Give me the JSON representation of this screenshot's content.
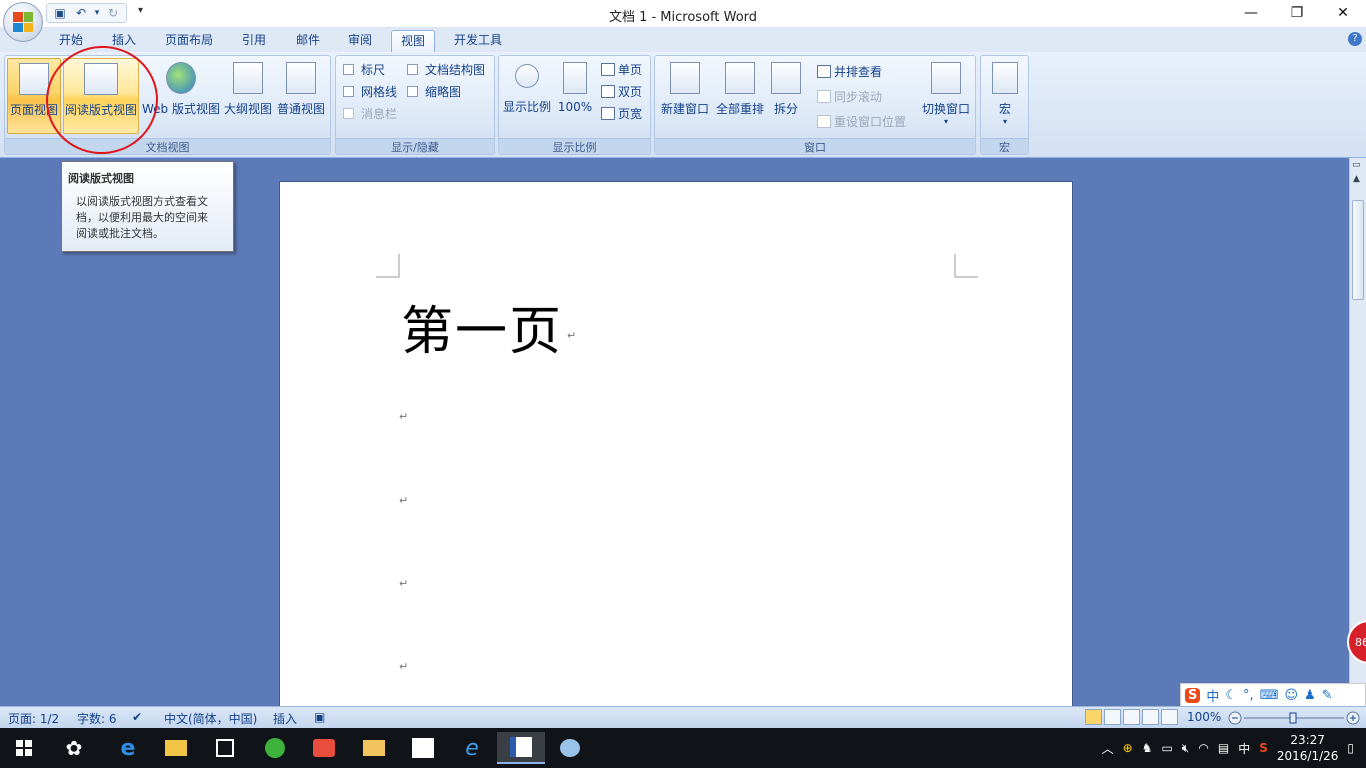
{
  "window": {
    "title": "文档 1 - Microsoft Word"
  },
  "window_controls": {
    "minimize": "—",
    "restore": "❐",
    "close": "✕"
  },
  "qat": {
    "more": "▾"
  },
  "ribbon_tabs": [
    "开始",
    "插入",
    "页面布局",
    "引用",
    "邮件",
    "审阅",
    "视图",
    "开发工具"
  ],
  "active_tab": "视图",
  "groups": {
    "doc_views": {
      "label": "文档视图",
      "buttons": [
        "页面视图",
        "阅读版式视图",
        "Web 版式视图",
        "大纲视图",
        "普通视图"
      ]
    },
    "show_hide": {
      "label": "显示/隐藏",
      "items": [
        "标尺",
        "网格线",
        "消息栏",
        "文档结构图",
        "缩略图"
      ]
    },
    "zoom": {
      "label": "显示比例",
      "big": [
        "显示比例",
        "100%"
      ],
      "small": [
        "单页",
        "双页",
        "页宽"
      ]
    },
    "window": {
      "label": "窗口",
      "big": [
        "新建窗口",
        "全部重排",
        "拆分"
      ],
      "small": [
        "并排查看",
        "同步滚动",
        "重设窗口位置"
      ],
      "switch": "切换窗口"
    },
    "macro": {
      "label": "宏",
      "button": "宏"
    }
  },
  "tooltip": {
    "title": "阅读版式视图",
    "line1": "以阅读版式视图方式查看文",
    "line2": "档，以便利用最大的空间来",
    "line3": "阅读或批注文档。"
  },
  "document": {
    "heading": "第一页",
    "para_mark": "↵"
  },
  "status": {
    "page": "页面: 1/2",
    "words": "字数: 6",
    "language": "中文(简体，中国)",
    "mode": "插入",
    "zoom": "100%"
  },
  "side_badge": "86",
  "ime": {
    "lang": "中"
  },
  "clock": {
    "time": "23:27",
    "date": "2016/1/26"
  },
  "tray": {
    "lang": "中"
  },
  "colors": {
    "accent_selected": "#f9c24a",
    "ribbon_bg": "#dbe7f6",
    "workspace": "#5d7ab8",
    "annotation": "#e0151b"
  }
}
